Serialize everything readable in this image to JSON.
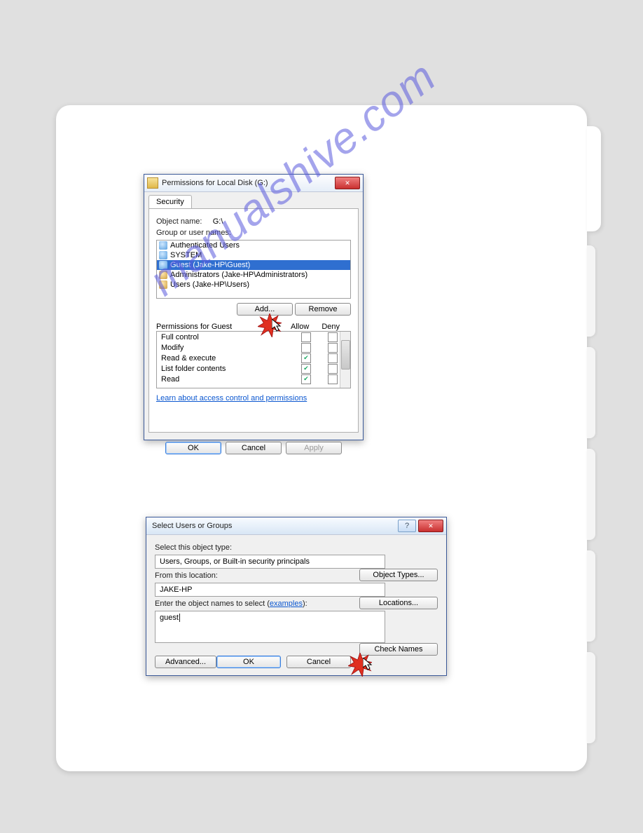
{
  "watermark": "manualshive.com",
  "dialog1": {
    "title": "Permissions for Local Disk (G:)",
    "tab": "Security",
    "object_label": "Object name:",
    "object_value": "G:\\",
    "groups_label": "Group or user names:",
    "groups": [
      "Authenticated Users",
      "SYSTEM",
      "Guest (Jake-HP\\Guest)",
      "Administrators (Jake-HP\\Administrators)",
      "Users (Jake-HP\\Users)"
    ],
    "selected_group_index": 2,
    "add_btn": "Add...",
    "remove_btn": "Remove",
    "perm_label": "Permissions for Guest",
    "col_allow": "Allow",
    "col_deny": "Deny",
    "permissions": [
      {
        "name": "Full control",
        "allow": false,
        "deny": false
      },
      {
        "name": "Modify",
        "allow": false,
        "deny": false
      },
      {
        "name": "Read & execute",
        "allow": true,
        "deny": false
      },
      {
        "name": "List folder contents",
        "allow": true,
        "deny": false
      },
      {
        "name": "Read",
        "allow": true,
        "deny": false
      }
    ],
    "learn_link": "Learn about access control and permissions",
    "ok": "OK",
    "cancel": "Cancel",
    "apply": "Apply"
  },
  "dialog2": {
    "title": "Select Users or Groups",
    "obj_type_label": "Select this object type:",
    "obj_type_value": "Users, Groups, or Built-in security principals",
    "obj_types_btn": "Object Types...",
    "loc_label": "From this location:",
    "loc_value": "JAKE-HP",
    "loc_btn": "Locations...",
    "names_label_pre": "Enter the object names to select (",
    "names_label_link": "examples",
    "names_label_post": "):",
    "names_value": "guest",
    "check_names_btn": "Check Names",
    "advanced_btn": "Advanced...",
    "ok": "OK",
    "cancel": "Cancel"
  }
}
